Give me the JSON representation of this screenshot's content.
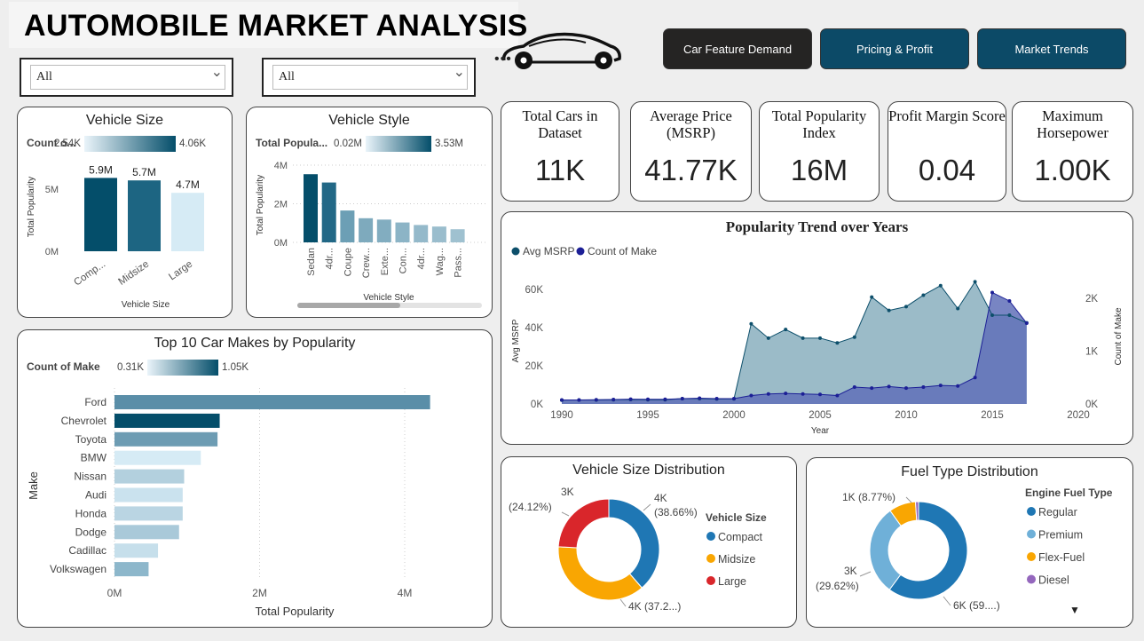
{
  "header": {
    "title": "AUTOMOBILE MARKET ANALYSIS"
  },
  "filters": [
    {
      "value": "All"
    },
    {
      "value": "All"
    }
  ],
  "nav": {
    "car_feature": "Car Feature Demand",
    "pricing": "Pricing & Profit",
    "trends": "Market Trends"
  },
  "colors": {
    "dark": "#044e6a",
    "teal": "#0d4f6b",
    "navy": "#1c1f96",
    "light": "#d6ebf5",
    "orange": "#f9a602",
    "red": "#d9262b",
    "blue": "#1f77b4",
    "lightblue": "#6fb0d8",
    "purple": "#9467bd"
  },
  "kpis": [
    {
      "label": "Total Cars in Dataset",
      "value": "11K"
    },
    {
      "label": "Average Price (MSRP)",
      "value": "41.77K"
    },
    {
      "label": "Total Popularity Index",
      "value": "16M"
    },
    {
      "label": "Profit Margin Score",
      "value": "0.04"
    },
    {
      "label": "Maximum Horsepower",
      "value": "1.00K"
    }
  ],
  "chart_data": [
    {
      "type": "bar",
      "title": "Vehicle Size",
      "legend_title": "Count o...",
      "gradient_min": "2.54K",
      "gradient_max": "4.06K",
      "xlabel": "Vehicle Size",
      "ylabel": "Total Popularity",
      "y_ticks": [
        "0M",
        "5M"
      ],
      "ylim": [
        0,
        7000000
      ],
      "categories": [
        "Comp...",
        "Midsize",
        "Large"
      ],
      "values": [
        5900000,
        5700000,
        4700000
      ],
      "data_labels": [
        "5.9M",
        "5.7M",
        "4.7M"
      ],
      "colors": [
        "#044e6a",
        "#1d6582",
        "#d6ebf5"
      ]
    },
    {
      "type": "bar",
      "title": "Vehicle Style",
      "legend_title": "Total Popula...",
      "gradient_min": "0.02M",
      "gradient_max": "3.53M",
      "xlabel": "Vehicle Style",
      "ylabel": "Total Popularity",
      "y_ticks": [
        "4M",
        "2M",
        "0M"
      ],
      "ylim": [
        0,
        4000000
      ],
      "categories": [
        "Sedan",
        "4dr...",
        "Coupe",
        "Crew...",
        "Exte...",
        "Con...",
        "4dr...",
        "Wag...",
        "Pass..."
      ],
      "values": [
        3530000,
        3100000,
        1650000,
        1250000,
        1180000,
        1030000,
        900000,
        820000,
        680000
      ],
      "colors": [
        "#044e6a",
        "#226886",
        "#6c9fb5",
        "#7eaabd",
        "#82adc0",
        "#8cb4c6",
        "#94b9ca",
        "#9abdcd",
        "#9fc1d0"
      ]
    },
    {
      "type": "bar",
      "title": "Top 10 Car Makes by Popularity",
      "legend_title": "Count of Make",
      "gradient_min": "0.31K",
      "gradient_max": "1.05K",
      "xlabel": "Total Popularity",
      "ylabel": "Make",
      "x_ticks": [
        "0M",
        "2M",
        "4M"
      ],
      "xlim": [
        0,
        4400000
      ],
      "categories": [
        "Ford",
        "Chevrolet",
        "Toyota",
        "BMW",
        "Nissan",
        "Audi",
        "Honda",
        "Dodge",
        "Cadillac",
        "Volkswagen"
      ],
      "values": [
        4350000,
        1450000,
        1420000,
        1190000,
        960000,
        940000,
        940000,
        890000,
        600000,
        470000
      ],
      "colors": [
        "#5a8ea8",
        "#044e6a",
        "#6d9cb3",
        "#d6ebf5",
        "#b3d0de",
        "#cae2ee",
        "#bad5e3",
        "#a9c9d9",
        "#c6dfeb",
        "#8db7cb"
      ]
    },
    {
      "type": "area",
      "title": "Popularity Trend over Years",
      "xlabel": "Year",
      "ylabel": "Avg MSRP",
      "y2label": "Count of Make",
      "x_ticks": [
        "1990",
        "1995",
        "2000",
        "2005",
        "2010",
        "2015",
        "2020"
      ],
      "y_ticks": [
        "0K",
        "20K",
        "40K",
        "60K"
      ],
      "y2_ticks": [
        "0K",
        "1K",
        "2K"
      ],
      "xlim": [
        1989,
        2020
      ],
      "ylim": [
        0,
        68000
      ],
      "y2lim": [
        0,
        2300
      ],
      "series": [
        {
          "name": "Avg MSRP",
          "x": [
            1990,
            1991,
            1992,
            1993,
            1994,
            1995,
            1996,
            1997,
            1998,
            1999,
            2000,
            2001,
            2002,
            2003,
            2004,
            2005,
            2006,
            2007,
            2008,
            2009,
            2010,
            2011,
            2012,
            2013,
            2014,
            2015,
            2016,
            2017
          ],
          "values": [
            2000,
            2100,
            2100,
            2200,
            2300,
            2200,
            2200,
            2800,
            2800,
            2600,
            2700,
            42000,
            34500,
            39000,
            34500,
            34500,
            32000,
            35000,
            56000,
            49000,
            51000,
            57000,
            62000,
            50000,
            64000,
            46500,
            46500,
            42500
          ]
        },
        {
          "name": "Count of Make",
          "x": [
            1990,
            1991,
            1992,
            1993,
            1994,
            1995,
            1996,
            1997,
            1998,
            1999,
            2000,
            2001,
            2002,
            2003,
            2004,
            2005,
            2006,
            2007,
            2008,
            2009,
            2010,
            2011,
            2012,
            2013,
            2014,
            2015,
            2016,
            2017
          ],
          "values": [
            75,
            75,
            80,
            85,
            90,
            88,
            88,
            100,
            110,
            100,
            100,
            160,
            190,
            200,
            190,
            180,
            160,
            320,
            300,
            330,
            300,
            320,
            350,
            340,
            500,
            2110,
            1950,
            1530
          ]
        }
      ]
    },
    {
      "type": "pie",
      "title": "Vehicle Size Distribution",
      "legend_title": "Vehicle Size",
      "labels": [
        "Compact",
        "Midsize",
        "Large"
      ],
      "values": [
        38.66,
        37.22,
        24.12
      ],
      "slice_labels": [
        "4K (38.66%)",
        "4K (37.2...)",
        "3K (24.12%)"
      ],
      "colors": [
        "#1f77b4",
        "#f9a602",
        "#d9262b"
      ]
    },
    {
      "type": "pie",
      "title": "Fuel Type Distribution",
      "legend_title": "Engine Fuel Type",
      "labels": [
        "Regular",
        "Premium",
        "Flex-Fuel",
        "Diesel"
      ],
      "values": [
        59.5,
        29.62,
        8.77,
        1.0
      ],
      "slice_labels": [
        "6K (59....)",
        "3K (29.62%)",
        "1K (8.77%)"
      ],
      "colors": [
        "#1f77b4",
        "#6fb0d8",
        "#f9a602",
        "#9467bd"
      ]
    }
  ]
}
